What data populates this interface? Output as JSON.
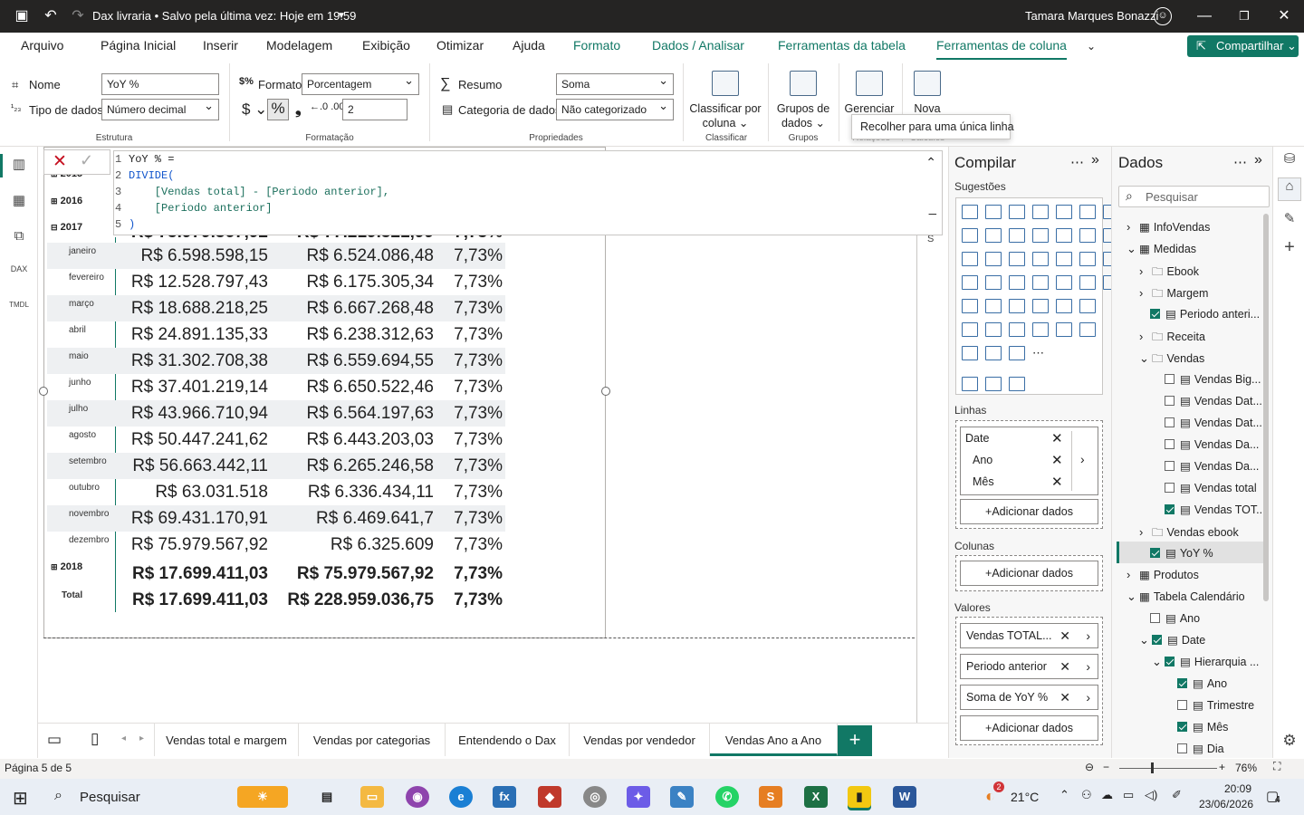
{
  "titlebar": {
    "doc_title": "Dax livraria • Salvo pela última vez: Hoje em 19:59",
    "user": "Tamara Marques Bonazzi"
  },
  "menu": {
    "items": [
      "Arquivo",
      "Página Inicial",
      "Inserir",
      "Modelagem",
      "Exibição",
      "Otimizar",
      "Ajuda",
      "Formato",
      "Dados / Analisar",
      "Ferramentas da tabela",
      "Ferramentas de coluna"
    ],
    "share": "Compartilhar"
  },
  "ribbon": {
    "name_label": "Nome",
    "name_value": "YoY %",
    "datatype_label": "Tipo de dados",
    "datatype_value": "Número decimal",
    "format_label": "Formato",
    "format_value": "Porcentagem",
    "decimals_value": "2",
    "summary_label": "Resumo",
    "summary_value": "Soma",
    "category_label": "Categoria de dados",
    "category_value": "Não categorizado",
    "sort_btn": "Classificar por coluna",
    "groups_btn": "Grupos de dados",
    "manage_btn": "Gerenciar",
    "new_btn": "Nova",
    "group_structure": "Estrutura",
    "group_format": "Formatação",
    "group_props": "Propriedades",
    "group_sort": "Classificar",
    "group_groups": "Grupos",
    "group_rel": "Relações",
    "group_calc": "Cálculos",
    "tooltip": "Recolher para uma única linha"
  },
  "formula": {
    "lines": [
      "YoY % =",
      "DIVIDE(",
      "    [Vendas total] - [Periodo anterior],",
      "    [Periodo anterior]",
      ")"
    ]
  },
  "matrix": {
    "years": [
      "2015",
      "2016",
      "2017",
      "2018"
    ],
    "partial_row": [
      "R$ 75.979.567,92",
      "R$ 77.219.521,99",
      "7,73%"
    ],
    "months": [
      {
        "m": "janeiro",
        "a": "R$ 6.598.598,15",
        "b": "R$ 6.524.086,48",
        "c": "7,73%"
      },
      {
        "m": "fevereiro",
        "a": "R$ 12.528.797,43",
        "b": "R$ 6.175.305,34",
        "c": "7,73%"
      },
      {
        "m": "março",
        "a": "R$ 18.688.218,25",
        "b": "R$ 6.667.268,48",
        "c": "7,73%"
      },
      {
        "m": "abril",
        "a": "R$ 24.891.135,33",
        "b": "R$ 6.238.312,63",
        "c": "7,73%"
      },
      {
        "m": "maio",
        "a": "R$ 31.302.708,38",
        "b": "R$ 6.559.694,55",
        "c": "7,73%"
      },
      {
        "m": "junho",
        "a": "R$ 37.401.219,14",
        "b": "R$ 6.650.522,46",
        "c": "7,73%"
      },
      {
        "m": "julho",
        "a": "R$ 43.966.710,94",
        "b": "R$ 6.564.197,63",
        "c": "7,73%"
      },
      {
        "m": "agosto",
        "a": "R$ 50.447.241,62",
        "b": "R$ 6.443.203,03",
        "c": "7,73%"
      },
      {
        "m": "setembro",
        "a": "R$ 56.663.442,11",
        "b": "R$ 6.265.246,58",
        "c": "7,73%"
      },
      {
        "m": "outubro",
        "a": "R$ 63.031.518",
        "b": "R$ 6.336.434,11",
        "c": "7,73%"
      },
      {
        "m": "novembro",
        "a": "R$ 69.431.170,91",
        "b": "R$ 6.469.641,7",
        "c": "7,73%"
      },
      {
        "m": "dezembro",
        "a": "R$ 75.979.567,92",
        "b": "R$ 6.325.609",
        "c": "7,73%"
      }
    ],
    "row_2018": [
      "R$ 17.699.411,03",
      "R$ 75.979.567,92",
      "7,73%"
    ],
    "total_label": "Total",
    "row_total": [
      "R$ 17.699.411,03",
      "R$ 228.959.036,75",
      "7,73%"
    ]
  },
  "pages": [
    "Vendas total e margem",
    "Vendas por categorias",
    "Entendendo o Dax",
    "Vendas por vendedor",
    "Vendas Ano a Ano"
  ],
  "status": {
    "page": "Página 5 de 5",
    "zoom": "76%"
  },
  "build": {
    "title": "Compilar",
    "suggestions": "Sugestões",
    "rows_label": "Linhas",
    "rows_fields": [
      "Date",
      "Ano",
      "Mês"
    ],
    "cols_label": "Colunas",
    "values_label": "Valores",
    "values_fields": [
      "Vendas TOTAL...",
      "Periodo anterior",
      "Soma de YoY %"
    ],
    "add": "+Adicionar dados"
  },
  "data": {
    "title": "Dados",
    "search_placeholder": "Pesquisar",
    "tree": [
      "InfoVendas",
      "Medidas",
      "Ebook",
      "Margem",
      "Periodo anteri...",
      "Receita",
      "Vendas",
      "Vendas Big...",
      "Vendas Dat...",
      "Vendas Dat...",
      "Vendas Da...",
      "Vendas Da...",
      "Vendas total",
      "Vendas TOT...",
      "Vendas ebook",
      "YoY %",
      "Produtos",
      "Tabela Calendário",
      "Ano",
      "Date",
      "Hierarquia ...",
      "Ano",
      "Trimestre",
      "Mês",
      "Dia"
    ]
  },
  "taskbar": {
    "search": "Pesquisar",
    "weather": "21°C",
    "time": "20:09",
    "date": "23/06/2026",
    "notif": "4",
    "badge": "2"
  },
  "colors": {
    "accent": "#117865",
    "titlebar": "#252423"
  }
}
